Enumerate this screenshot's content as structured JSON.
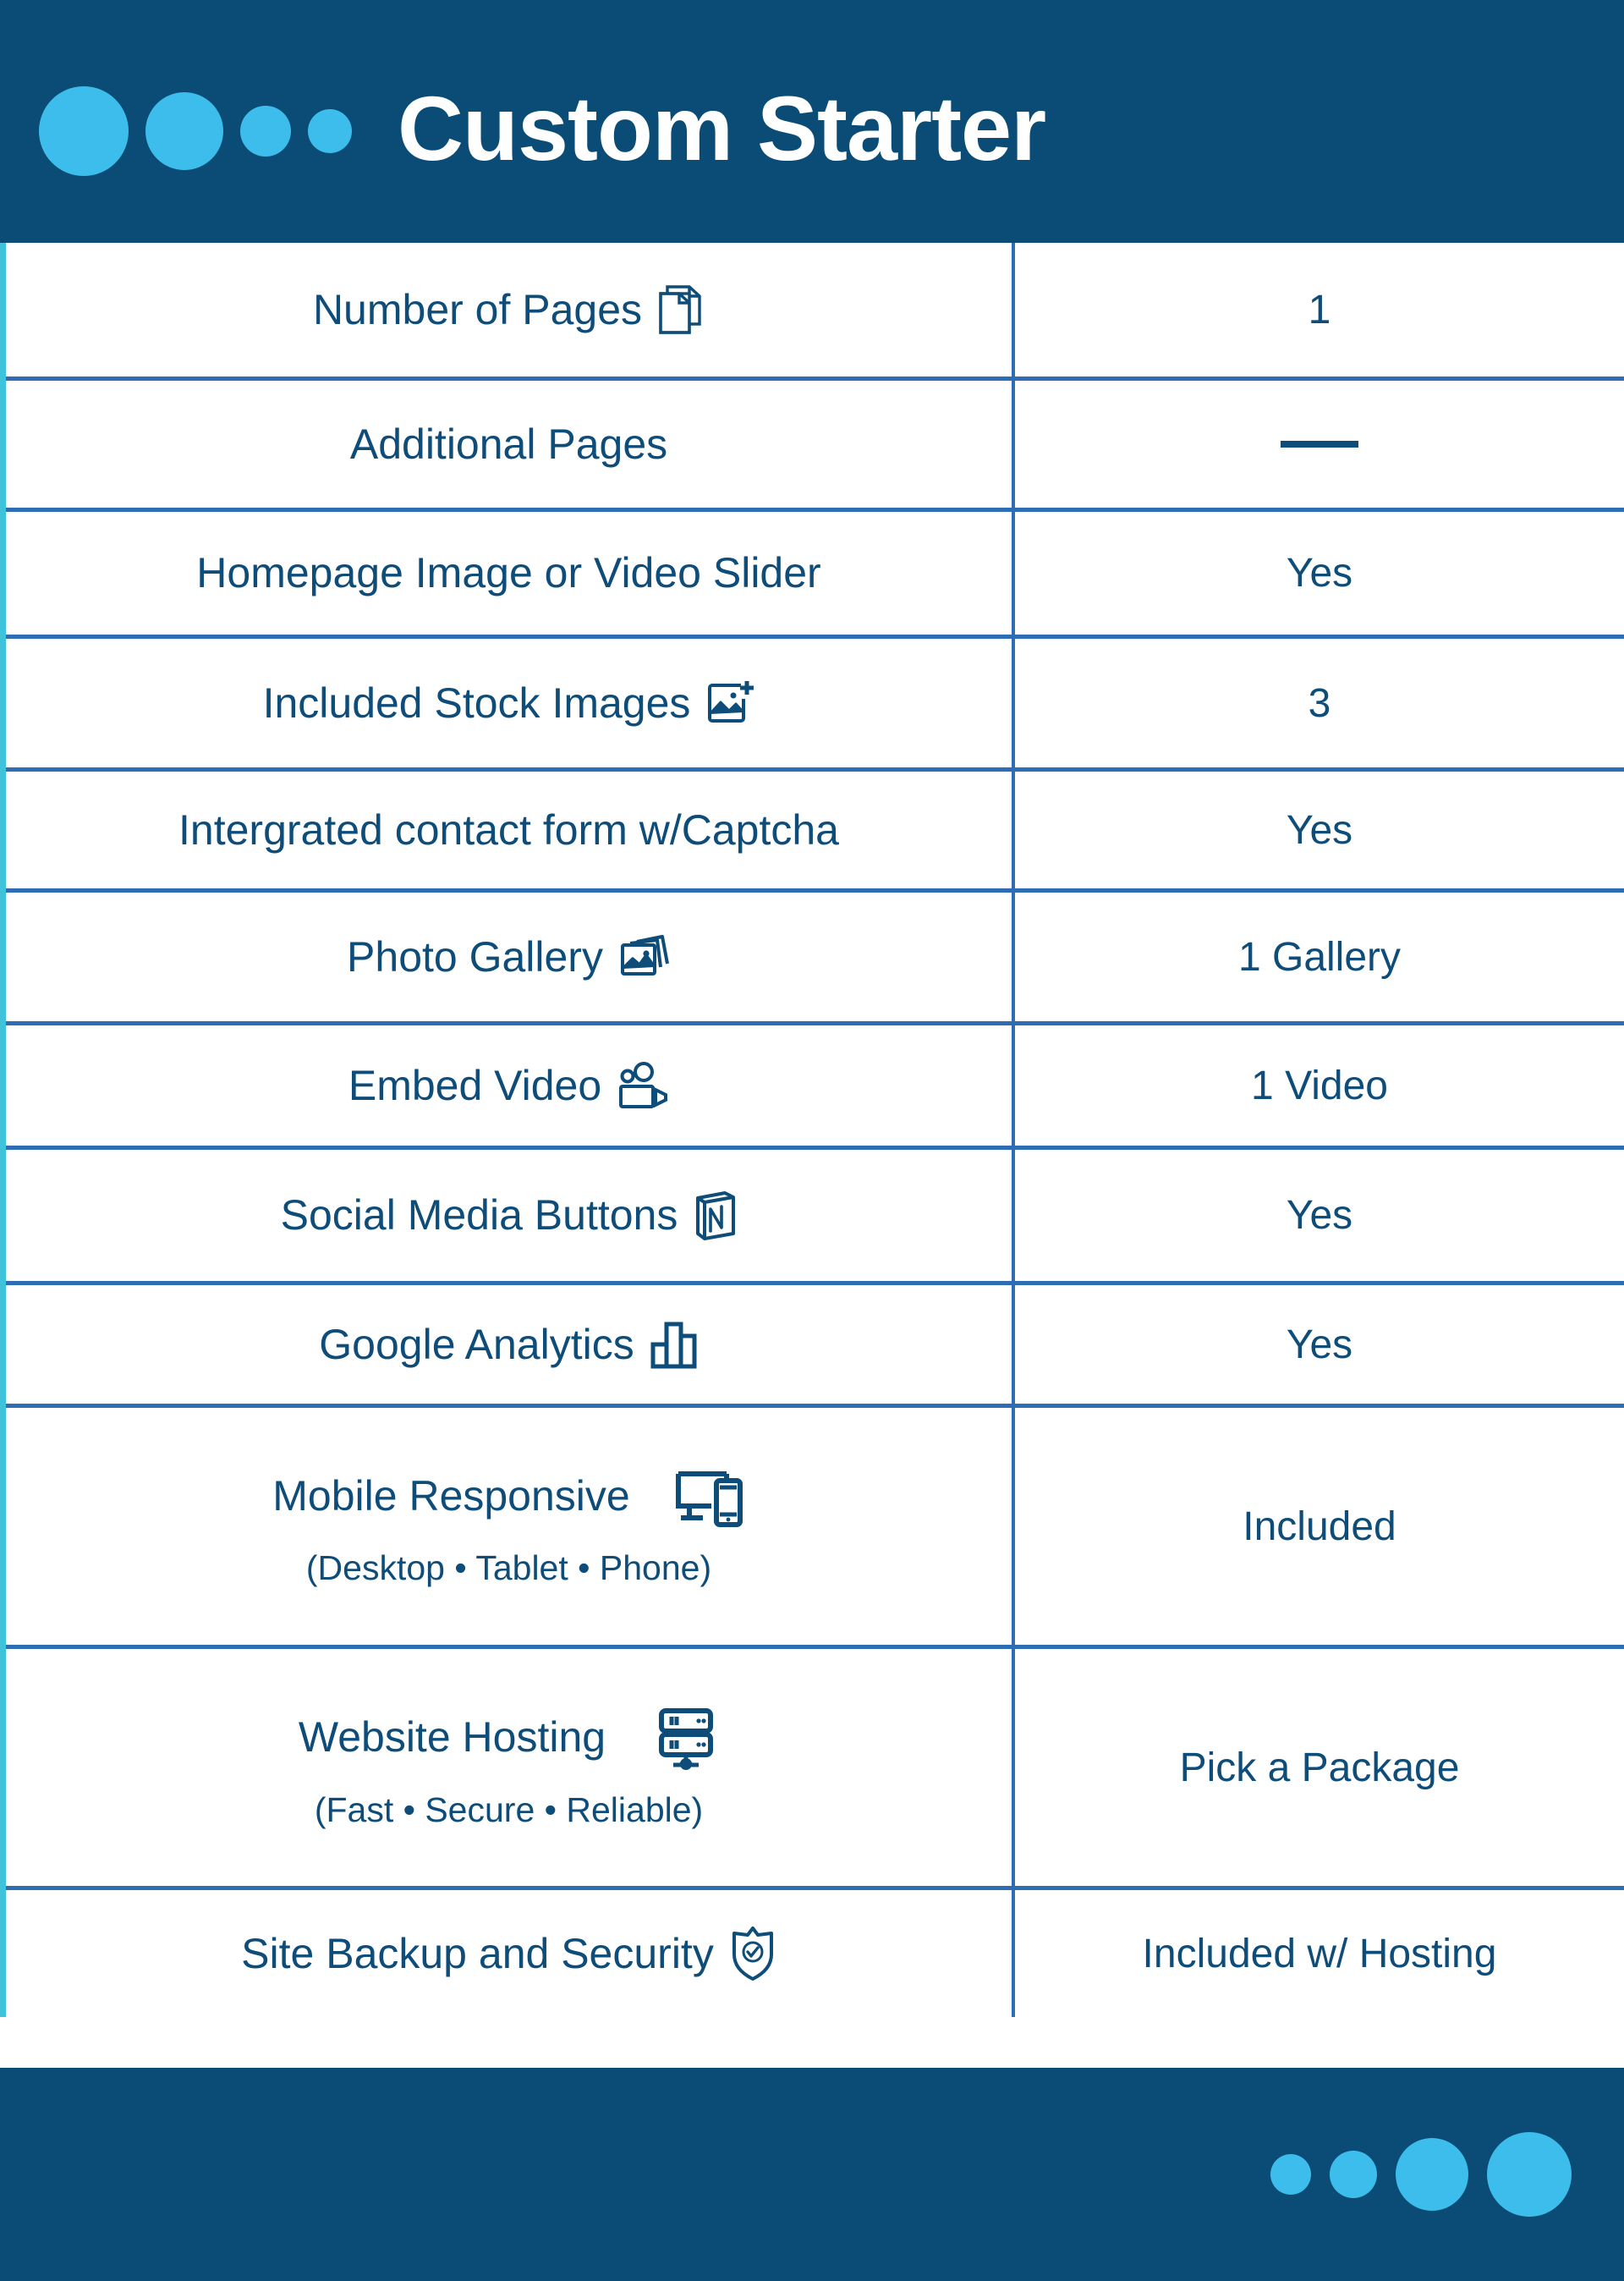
{
  "header": {
    "title": "Custom Starter",
    "dots": [
      "large",
      "medium",
      "small",
      "xsmall"
    ],
    "bg_color": "#0A4C75",
    "dot_color": "#3CBDEB",
    "title_color": "#FFFFFF"
  },
  "theme": {
    "text_color": "#0E4C79",
    "divider_color": "#2E6DB4",
    "left_accent_color": "#3FC3DA",
    "background": "#FFFFFF"
  },
  "table": {
    "rows": [
      {
        "label": "Number of Pages",
        "icon": "pages-icon",
        "sub": "",
        "value": "1"
      },
      {
        "label": "Additional Pages",
        "icon": "",
        "sub": "",
        "value": "——"
      },
      {
        "label": "Homepage Image or Video Slider",
        "icon": "",
        "sub": "",
        "value": "Yes"
      },
      {
        "label": "Included Stock Images",
        "icon": "add-image-icon",
        "sub": "",
        "value": "3"
      },
      {
        "label": "Intergrated contact form w/Captcha",
        "icon": "",
        "sub": "",
        "value": "Yes"
      },
      {
        "label": "Photo Gallery",
        "icon": "photo-gallery-icon",
        "sub": "",
        "value": "1 Gallery"
      },
      {
        "label": "Embed Video",
        "icon": "video-camera-icon",
        "sub": "",
        "value": "1 Video"
      },
      {
        "label": "Social Media Buttons",
        "icon": "social-box-icon",
        "sub": "",
        "value": "Yes"
      },
      {
        "label": "Google Analytics",
        "icon": "bar-chart-icon",
        "sub": "",
        "value": "Yes"
      },
      {
        "label": "Mobile Responsive",
        "icon": "devices-icon",
        "sub": "(Desktop • Tablet •  Phone)",
        "value": "Included"
      },
      {
        "label": "Website Hosting",
        "icon": "server-icon",
        "sub": "(Fast • Secure • Reliable)",
        "value": "Pick a Package"
      },
      {
        "label": "Site Backup and Security",
        "icon": "shield-check-icon",
        "sub": "",
        "value": "Included w/ Hosting"
      }
    ]
  },
  "footer": {
    "dots": [
      "xsmall",
      "small",
      "medium",
      "large"
    ],
    "bg_color": "#0A4C75",
    "dot_color": "#3CBDEB"
  }
}
